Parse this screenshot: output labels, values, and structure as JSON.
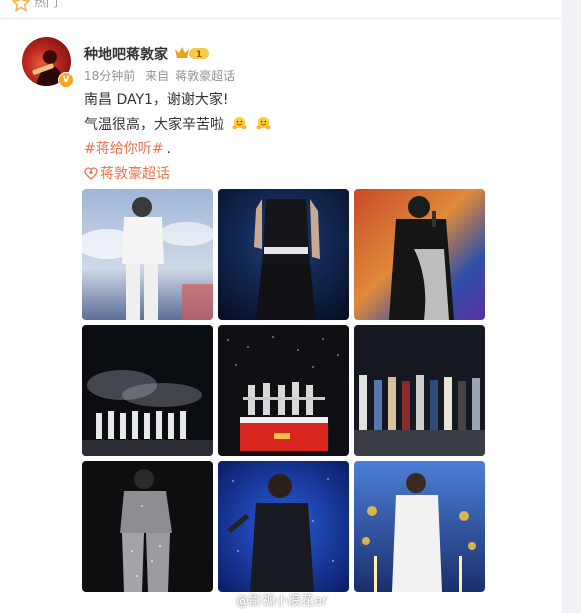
{
  "top": {
    "label": "热门"
  },
  "post": {
    "username": "种地吧蒋敦家",
    "fan_level": "1",
    "time": "18分钟前",
    "source_prefix": "来自",
    "source": "蒋敦豪超话",
    "line1": "南昌 DAY1，谢谢大家!",
    "line2": "气温很高，大家辛苦啦",
    "hashtag": "#蒋给你听#",
    "hashtag_suffix": ".",
    "super_topic": "蒋敦豪超话",
    "verified_mark": "V"
  },
  "images": [
    {
      "name": "photo-1",
      "desc": "performer in white suit"
    },
    {
      "name": "photo-2",
      "desc": "performer in black"
    },
    {
      "name": "photo-3",
      "desc": "performer on colorful stage"
    },
    {
      "name": "photo-4",
      "desc": "group bowing on smoky stage"
    },
    {
      "name": "photo-5",
      "desc": "group on red cart"
    },
    {
      "name": "photo-6",
      "desc": "group on stage"
    },
    {
      "name": "photo-7",
      "desc": "performer in sequined suit"
    },
    {
      "name": "photo-8",
      "desc": "performer on blue stage"
    },
    {
      "name": "photo-9",
      "desc": "performer in white with sparklers"
    }
  ],
  "watermark": "@影视小浪花er",
  "colors": {
    "accent": "#eb7350",
    "meta": "#939393",
    "badge": "#f5a623"
  }
}
